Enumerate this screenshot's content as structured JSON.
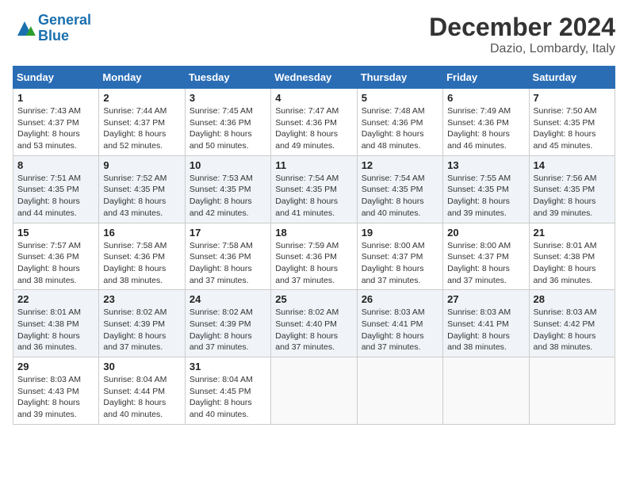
{
  "header": {
    "logo_line1": "General",
    "logo_line2": "Blue",
    "title": "December 2024",
    "subtitle": "Dazio, Lombardy, Italy"
  },
  "weekdays": [
    "Sunday",
    "Monday",
    "Tuesday",
    "Wednesday",
    "Thursday",
    "Friday",
    "Saturday"
  ],
  "weeks": [
    [
      {
        "day": "1",
        "sunrise": "Sunrise: 7:43 AM",
        "sunset": "Sunset: 4:37 PM",
        "daylight": "Daylight: 8 hours and 53 minutes."
      },
      {
        "day": "2",
        "sunrise": "Sunrise: 7:44 AM",
        "sunset": "Sunset: 4:37 PM",
        "daylight": "Daylight: 8 hours and 52 minutes."
      },
      {
        "day": "3",
        "sunrise": "Sunrise: 7:45 AM",
        "sunset": "Sunset: 4:36 PM",
        "daylight": "Daylight: 8 hours and 50 minutes."
      },
      {
        "day": "4",
        "sunrise": "Sunrise: 7:47 AM",
        "sunset": "Sunset: 4:36 PM",
        "daylight": "Daylight: 8 hours and 49 minutes."
      },
      {
        "day": "5",
        "sunrise": "Sunrise: 7:48 AM",
        "sunset": "Sunset: 4:36 PM",
        "daylight": "Daylight: 8 hours and 48 minutes."
      },
      {
        "day": "6",
        "sunrise": "Sunrise: 7:49 AM",
        "sunset": "Sunset: 4:36 PM",
        "daylight": "Daylight: 8 hours and 46 minutes."
      },
      {
        "day": "7",
        "sunrise": "Sunrise: 7:50 AM",
        "sunset": "Sunset: 4:35 PM",
        "daylight": "Daylight: 8 hours and 45 minutes."
      }
    ],
    [
      {
        "day": "8",
        "sunrise": "Sunrise: 7:51 AM",
        "sunset": "Sunset: 4:35 PM",
        "daylight": "Daylight: 8 hours and 44 minutes."
      },
      {
        "day": "9",
        "sunrise": "Sunrise: 7:52 AM",
        "sunset": "Sunset: 4:35 PM",
        "daylight": "Daylight: 8 hours and 43 minutes."
      },
      {
        "day": "10",
        "sunrise": "Sunrise: 7:53 AM",
        "sunset": "Sunset: 4:35 PM",
        "daylight": "Daylight: 8 hours and 42 minutes."
      },
      {
        "day": "11",
        "sunrise": "Sunrise: 7:54 AM",
        "sunset": "Sunset: 4:35 PM",
        "daylight": "Daylight: 8 hours and 41 minutes."
      },
      {
        "day": "12",
        "sunrise": "Sunrise: 7:54 AM",
        "sunset": "Sunset: 4:35 PM",
        "daylight": "Daylight: 8 hours and 40 minutes."
      },
      {
        "day": "13",
        "sunrise": "Sunrise: 7:55 AM",
        "sunset": "Sunset: 4:35 PM",
        "daylight": "Daylight: 8 hours and 39 minutes."
      },
      {
        "day": "14",
        "sunrise": "Sunrise: 7:56 AM",
        "sunset": "Sunset: 4:35 PM",
        "daylight": "Daylight: 8 hours and 39 minutes."
      }
    ],
    [
      {
        "day": "15",
        "sunrise": "Sunrise: 7:57 AM",
        "sunset": "Sunset: 4:36 PM",
        "daylight": "Daylight: 8 hours and 38 minutes."
      },
      {
        "day": "16",
        "sunrise": "Sunrise: 7:58 AM",
        "sunset": "Sunset: 4:36 PM",
        "daylight": "Daylight: 8 hours and 38 minutes."
      },
      {
        "day": "17",
        "sunrise": "Sunrise: 7:58 AM",
        "sunset": "Sunset: 4:36 PM",
        "daylight": "Daylight: 8 hours and 37 minutes."
      },
      {
        "day": "18",
        "sunrise": "Sunrise: 7:59 AM",
        "sunset": "Sunset: 4:36 PM",
        "daylight": "Daylight: 8 hours and 37 minutes."
      },
      {
        "day": "19",
        "sunrise": "Sunrise: 8:00 AM",
        "sunset": "Sunset: 4:37 PM",
        "daylight": "Daylight: 8 hours and 37 minutes."
      },
      {
        "day": "20",
        "sunrise": "Sunrise: 8:00 AM",
        "sunset": "Sunset: 4:37 PM",
        "daylight": "Daylight: 8 hours and 37 minutes."
      },
      {
        "day": "21",
        "sunrise": "Sunrise: 8:01 AM",
        "sunset": "Sunset: 4:38 PM",
        "daylight": "Daylight: 8 hours and 36 minutes."
      }
    ],
    [
      {
        "day": "22",
        "sunrise": "Sunrise: 8:01 AM",
        "sunset": "Sunset: 4:38 PM",
        "daylight": "Daylight: 8 hours and 36 minutes."
      },
      {
        "day": "23",
        "sunrise": "Sunrise: 8:02 AM",
        "sunset": "Sunset: 4:39 PM",
        "daylight": "Daylight: 8 hours and 37 minutes."
      },
      {
        "day": "24",
        "sunrise": "Sunrise: 8:02 AM",
        "sunset": "Sunset: 4:39 PM",
        "daylight": "Daylight: 8 hours and 37 minutes."
      },
      {
        "day": "25",
        "sunrise": "Sunrise: 8:02 AM",
        "sunset": "Sunset: 4:40 PM",
        "daylight": "Daylight: 8 hours and 37 minutes."
      },
      {
        "day": "26",
        "sunrise": "Sunrise: 8:03 AM",
        "sunset": "Sunset: 4:41 PM",
        "daylight": "Daylight: 8 hours and 37 minutes."
      },
      {
        "day": "27",
        "sunrise": "Sunrise: 8:03 AM",
        "sunset": "Sunset: 4:41 PM",
        "daylight": "Daylight: 8 hours and 38 minutes."
      },
      {
        "day": "28",
        "sunrise": "Sunrise: 8:03 AM",
        "sunset": "Sunset: 4:42 PM",
        "daylight": "Daylight: 8 hours and 38 minutes."
      }
    ],
    [
      {
        "day": "29",
        "sunrise": "Sunrise: 8:03 AM",
        "sunset": "Sunset: 4:43 PM",
        "daylight": "Daylight: 8 hours and 39 minutes."
      },
      {
        "day": "30",
        "sunrise": "Sunrise: 8:04 AM",
        "sunset": "Sunset: 4:44 PM",
        "daylight": "Daylight: 8 hours and 40 minutes."
      },
      {
        "day": "31",
        "sunrise": "Sunrise: 8:04 AM",
        "sunset": "Sunset: 4:45 PM",
        "daylight": "Daylight: 8 hours and 40 minutes."
      },
      null,
      null,
      null,
      null
    ]
  ]
}
